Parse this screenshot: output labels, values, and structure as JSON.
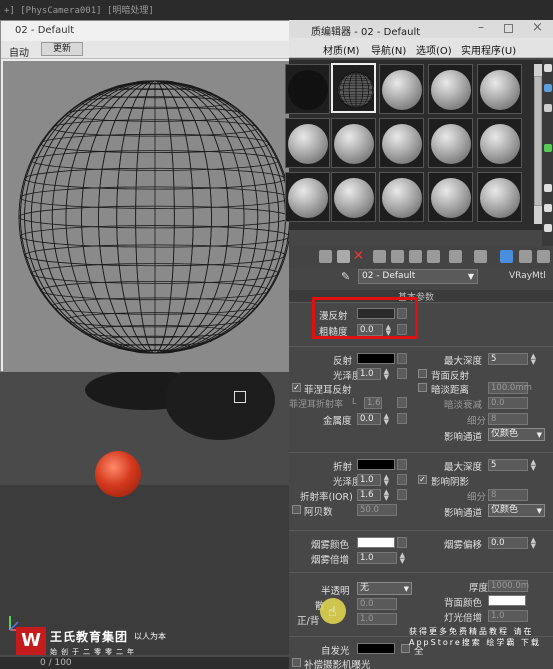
{
  "viewport": {
    "topbar_text": "+] [PhysCamera001] [明暗处理]",
    "frame_counter": "0 / 100"
  },
  "preview": {
    "title": "02 - Default",
    "close": "×",
    "auto_label": "自动",
    "update_label": "更新"
  },
  "editor": {
    "title": "质编辑器 - 02 - Default",
    "menus": [
      "材质(M)",
      "导航(N)",
      "选项(O)",
      "实用程序(U)"
    ],
    "material_name": "02 - Default",
    "material_type": "VRayMtl",
    "rollout_title": "基本参数"
  },
  "diffuse": {
    "diffuse_label": "漫反射",
    "roughness_label": "粗糙度",
    "roughness_value": "0.0"
  },
  "reflection": {
    "reflect_label": "反射",
    "gloss_label": "光泽度",
    "gloss_value": "1.0",
    "fresnel_label": "菲涅耳反射",
    "fresnel_ior_label": "菲涅耳折射率",
    "fresnel_ior_lock": "L",
    "fresnel_ior_value": "1.6",
    "metalness_label": "金属度",
    "metalness_value": "0.0",
    "max_depth_label": "最大深度",
    "max_depth_value": "5",
    "backside_label": "背面反射",
    "dim_distance_label": "暗淡距离",
    "dim_distance_value": "100.0mm",
    "dim_falloff_label": "暗淡衰减",
    "dim_falloff_value": "0.0",
    "subdivs_label": "细分",
    "subdivs_value": "8",
    "affect_label": "影响通道",
    "affect_value": "仅颜色"
  },
  "refraction": {
    "refract_label": "折射",
    "gloss_label": "光泽度",
    "gloss_value": "1.0",
    "ior_label": "折射率(IOR)",
    "ior_value": "1.6",
    "abbe_label": "阿贝数",
    "abbe_value": "50.0",
    "max_depth_label": "最大深度",
    "max_depth_value": "5",
    "affect_shadows_label": "影响阴影",
    "subdivs_label": "细分",
    "subdivs_value": "8",
    "affect_label": "影响通道",
    "affect_value": "仅颜色"
  },
  "fog": {
    "color_label": "烟雾颜色",
    "multiplier_label": "烟雾倍增",
    "multiplier_value": "1.0",
    "bias_label": "烟雾偏移",
    "bias_value": "0.0"
  },
  "translucency": {
    "label": "半透明",
    "mode_value": "无",
    "thickness_label": "厚度",
    "thickness_value": "1000.0m",
    "scatter_label": "散",
    "scatter_value": "0.0",
    "backside_color_label": "背面颜色",
    "front_back_label": "正/背",
    "front_back_value": "1.0",
    "light_mult_label": "灯光倍增",
    "light_mult_value": "1.0"
  },
  "self_illum": {
    "label": "自发光",
    "gi_label": "全",
    "compensate_label": "补偿摄影机曝光"
  },
  "watermark": {
    "logo_char": "W",
    "company": "王氏教育集团",
    "slogan": "始创于二零零二年",
    "side_text": "以人为本",
    "right_text": "获得更多免费精品教程 请在AppStore搜索 绘学霸 下载"
  },
  "colors": {
    "highlight": "#e01010",
    "reflect_swatch": "#000000",
    "diffuse_swatch": "#2a2a2a",
    "fog_swatch": "#ffffff",
    "backside_swatch": "#ffffff",
    "selfillum_swatch": "#000000"
  }
}
